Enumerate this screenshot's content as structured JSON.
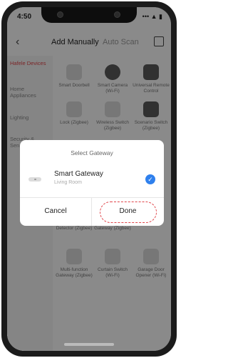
{
  "status_bar": {
    "time": "4:50",
    "icons": "••• ▲ ▮"
  },
  "header": {
    "tab_add": "Add Manually",
    "tab_scan": "Auto Scan"
  },
  "sidebar": {
    "items": [
      "Hafele Devices",
      "Home Appliances",
      "Lighting",
      "Security & Sensors"
    ]
  },
  "grid": {
    "row1": [
      "Smart Doorbell",
      "Smart Camera (Wi-Fi)",
      "Universal Remote Control"
    ],
    "row2": [
      "Lock (Zigbee)",
      "Wireless Switch (Zigbee)",
      "Scenario Switch (Zigbee)"
    ],
    "row3": [
      "Detector (Zigbee)",
      "Gateway (Zigbee)"
    ],
    "row4": [
      "Multi-function Gateway (Zigbee)",
      "Curtain Switch (Wi-Fi)",
      "Garage Door Opener (Wi-Fi)"
    ]
  },
  "dialog": {
    "title": "Select Gateway",
    "gateway_name": "Smart Gateway",
    "gateway_room": "Living Room",
    "cancel_label": "Cancel",
    "done_label": "Done"
  },
  "colors": {
    "accent": "#e0454a",
    "check": "#2f80ed"
  }
}
